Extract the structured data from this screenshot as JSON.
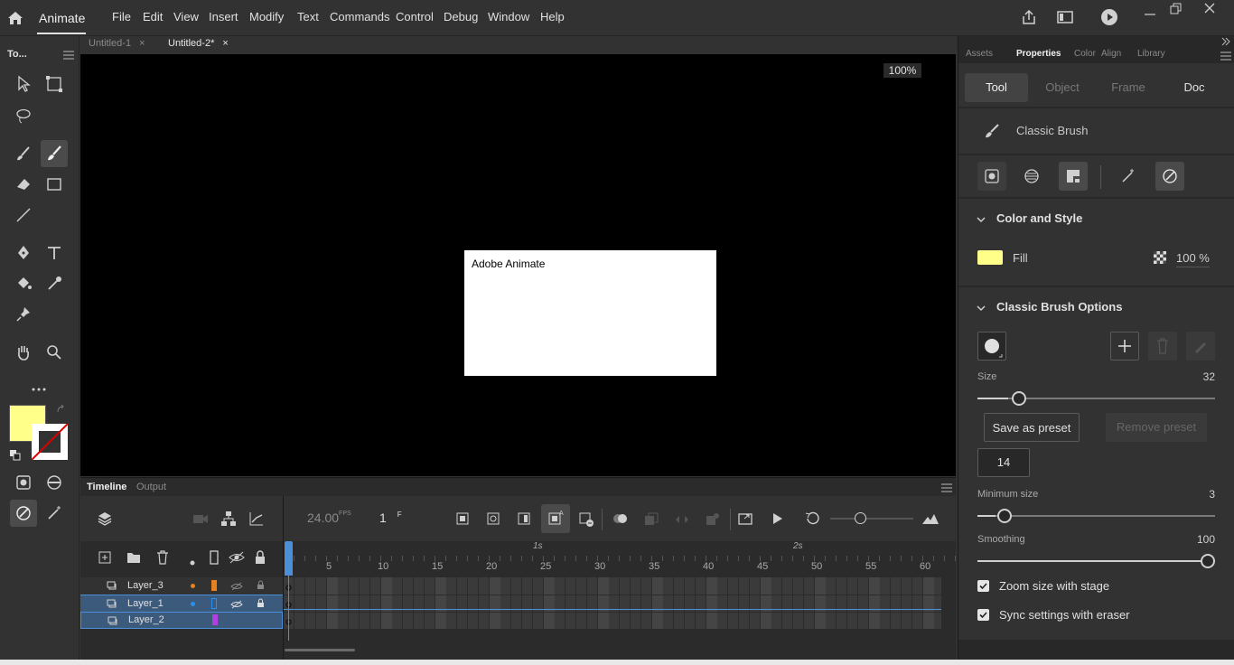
{
  "app": {
    "name": "Animate"
  },
  "menu": [
    "File",
    "Edit",
    "View",
    "Insert",
    "Modify",
    "Text",
    "Commands",
    "Control",
    "Debug",
    "Window",
    "Help"
  ],
  "doc_tabs": [
    {
      "label": "Untitled-1"
    },
    {
      "label": "Untitled-2*"
    }
  ],
  "toolbar": {
    "title": "To..."
  },
  "stage": {
    "zoom": "100%",
    "canvas_text": "Adobe Animate"
  },
  "colors": {
    "fill": "#ffff8a",
    "accent": "#4a8fd8",
    "stage": "#000000"
  },
  "timeline": {
    "tabs": [
      "Timeline",
      "Output"
    ],
    "fps": "24.00",
    "fps_unit": "FPS",
    "frame": "1",
    "frame_unit": "F",
    "second_markers": [
      "1s",
      "2s"
    ],
    "frame_numbers": [
      "5",
      "10",
      "15",
      "20",
      "25",
      "30",
      "35",
      "40",
      "45",
      "50",
      "55",
      "60"
    ],
    "layers": [
      {
        "name": "Layer_3",
        "dot_color": "#e8801c",
        "swatch": "#e8801c",
        "selected": false
      },
      {
        "name": "Layer_1",
        "dot_color": "#2a8df2",
        "swatch": "#2a8df2",
        "selected": true
      },
      {
        "name": "Layer_2",
        "dot_color": "",
        "swatch": "#b040e0",
        "selected": true
      }
    ]
  },
  "props": {
    "panel_tabs": [
      "Assets",
      "Properties",
      "Color",
      "Align",
      "Library"
    ],
    "sub_tabs": [
      "Tool",
      "Object",
      "Frame",
      "Doc"
    ],
    "tool_name": "Classic Brush",
    "color_style": {
      "title": "Color and Style",
      "fill_label": "Fill",
      "alpha": "100 %"
    },
    "brush_options": {
      "title": "Classic Brush Options",
      "size_label": "Size",
      "size_value": "32",
      "size_fraction": 0.13,
      "save_preset": "Save as preset",
      "remove_preset": "Remove preset",
      "preset_value": "14",
      "min_size_label": "Minimum size",
      "min_size_value": "3",
      "min_size_fraction": 0.1,
      "smoothing_label": "Smoothing",
      "smoothing_value": "100",
      "smoothing_fraction": 1.0,
      "zoom_size_label": "Zoom size with stage",
      "sync_label": "Sync settings with eraser"
    }
  }
}
